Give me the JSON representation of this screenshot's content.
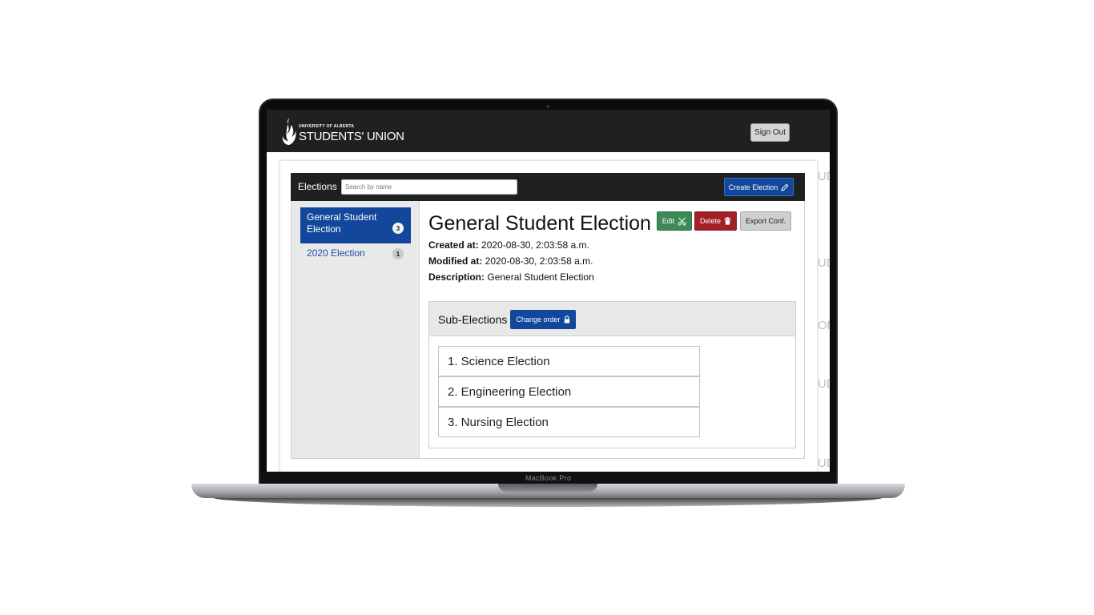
{
  "device": {
    "model_label": "MacBook Pro"
  },
  "header": {
    "logo": {
      "small_text": "UNIVERSITY OF ALBERTA",
      "big_text": "STUDENTS' UNION"
    },
    "signout_label": "Sign Out"
  },
  "toolbar": {
    "section_label": "Elections",
    "search_placeholder": "Search by name",
    "create_label": "Create Election"
  },
  "sidebar": {
    "items": [
      {
        "label": "General Student Election",
        "count": "3",
        "active": true
      },
      {
        "label": "2020 Election",
        "count": "1",
        "active": false
      }
    ]
  },
  "detail": {
    "title": "General Student Election",
    "created_label": "Created at:",
    "created_value": "2020-08-30, 2:03:58 a.m.",
    "modified_label": "Modified at:",
    "modified_value": "2020-08-30, 2:03:58 a.m.",
    "description_label": "Description:",
    "description_value": "General Student Election",
    "actions": {
      "edit": "Edit",
      "delete": "Delete",
      "export": "Export Conf."
    }
  },
  "sub_elections": {
    "title": "Sub-Elections",
    "change_order_label": "Change order",
    "items": [
      "1. Science Election",
      "2. Engineering Election",
      "3. Nursing Election"
    ]
  },
  "watermark": [
    "UD",
    "UD",
    "ON",
    "UD",
    "UD"
  ],
  "colors": {
    "header_bg": "#1f2121",
    "primary": "#12479b",
    "edit": "#3c8a55",
    "delete": "#a32025",
    "neutral": "#cfcfcf"
  }
}
